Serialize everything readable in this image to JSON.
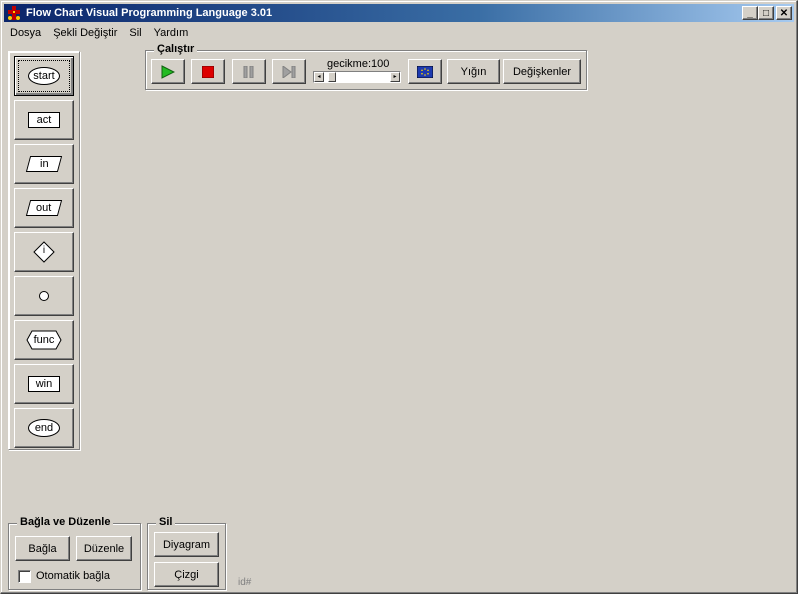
{
  "window": {
    "title": "Flow Chart Visual Programming Language 3.01",
    "minimize": "_",
    "maximize": "□",
    "close": "✕"
  },
  "menu": [
    "Dosya",
    "Şekli Değiştir",
    "Sil",
    "Yardım"
  ],
  "palette": [
    "start",
    "act",
    "in",
    "out",
    "i",
    "",
    "func",
    "win",
    "end"
  ],
  "run": {
    "title": "Çalıştır",
    "play_icon": "play-icon",
    "stop_icon": "stop-icon",
    "pause_icon": "pause-icon",
    "step_icon": "step-icon",
    "delay_label": "gecikme:100",
    "delay_value": 100,
    "stack_label": "Yığın",
    "variables_label": "Değişkenler"
  },
  "connect": {
    "title": "Bağla ve Düzenle",
    "connect_label": "Bağla",
    "edit_label": "Düzenle",
    "auto_label": "Otomatik bağla",
    "auto_checked": false
  },
  "delete": {
    "title": "Sil",
    "diagram_label": "Diyagram",
    "line_label": "Çizgi"
  },
  "status": {
    "id_text": "id#"
  },
  "colors": {
    "title_start": "#0a246a",
    "title_end": "#a6caf0",
    "play": "#22bb22",
    "stop": "#dd0000",
    "face": "#d4d0c8"
  }
}
